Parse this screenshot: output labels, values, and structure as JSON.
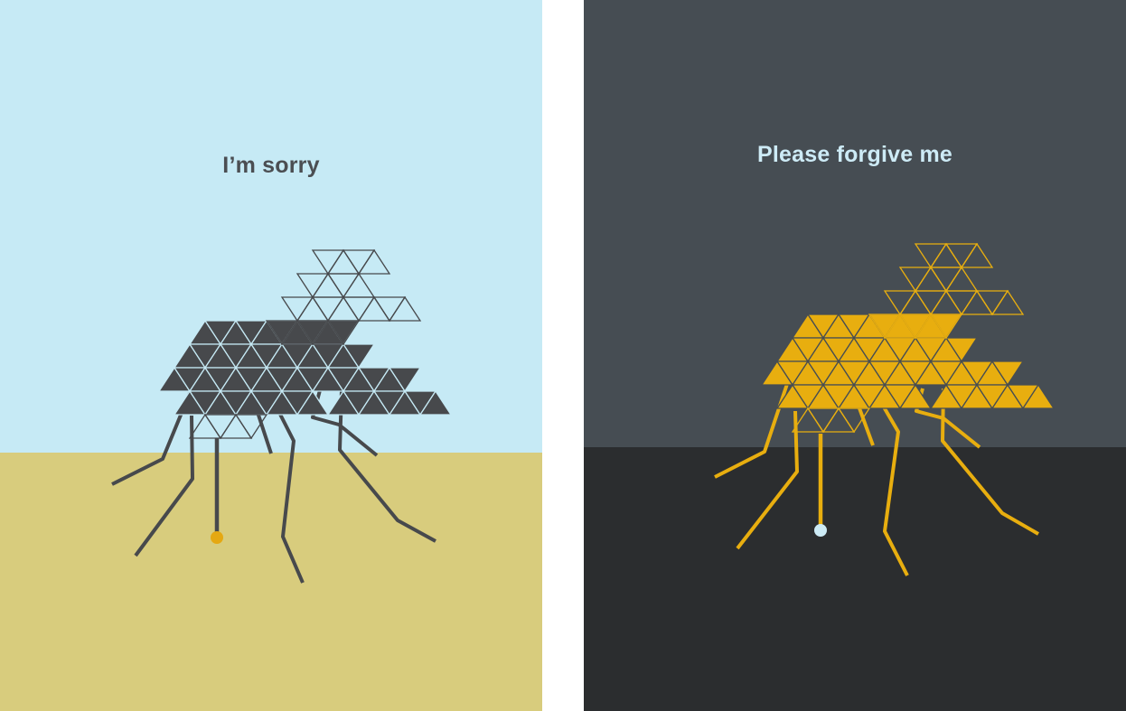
{
  "panels": [
    {
      "caption": "I’m sorry",
      "colors": {
        "sky": "#c6eaf5",
        "ground": "#d8cc7d",
        "body": "#47494c",
        "wing": "#47494c",
        "drop": "#e5a812",
        "caption": "#4b4e52"
      }
    },
    {
      "caption": "Please forgive me",
      "colors": {
        "sky": "#464d53",
        "ground": "#2b2d2f",
        "body": "#e8ae0f",
        "wing": "#e8ae0f",
        "drop": "#cdebf6",
        "caption": "#cdebf6"
      }
    }
  ]
}
